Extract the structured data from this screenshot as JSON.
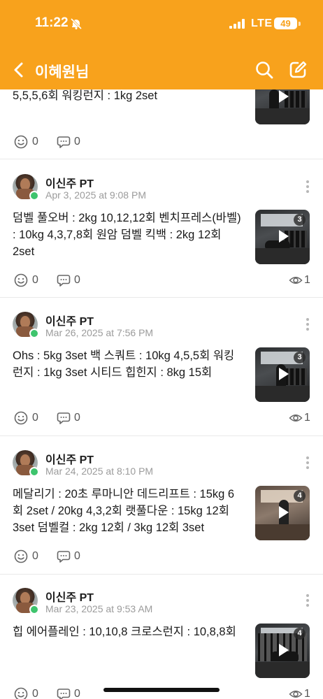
{
  "status_bar": {
    "time": "11:22",
    "network": "LTE",
    "battery": "49"
  },
  "nav": {
    "title": "이혜원님"
  },
  "colors": {
    "header": "#f8a21c",
    "badge": "#3ec46d"
  },
  "posts": [
    {
      "text": "5,5,5,6회 워킹런지 : 1kg 2set",
      "reactions": "0",
      "comments": "0"
    },
    {
      "author": "이신주 PT",
      "date": "Apr 3, 2025 at 9:08 PM",
      "text": "덤벨 풀오버 : 2kg 10,12,12회 벤치프레스(바벨) : 10kg 4,3,7,8회 원암 덤벨 킥백 : 2kg 12회 2set",
      "media_count": "3",
      "reactions": "0",
      "comments": "0",
      "views": "1"
    },
    {
      "author": "이신주 PT",
      "date": "Mar 26, 2025 at 7:56 PM",
      "text": "Ohs : 5kg 3set 백 스쿼트 : 10kg 4,5,5회 워킹런지 : 1kg 3set 시티드 힙힌지 : 8kg 15회",
      "media_count": "3",
      "reactions": "0",
      "comments": "0",
      "views": "1"
    },
    {
      "author": "이신주 PT",
      "date": "Mar 24, 2025 at 8:10 PM",
      "text": "메달리기 : 20초 루마니안 데드리프트 : 15kg 6회 2set / 20kg 4,3,2회 랫풀다운 : 15kg 12회 3set 덤벨컬 : 2kg 12회 / 3kg 12회 3set",
      "media_count": "4",
      "reactions": "0",
      "comments": "0"
    },
    {
      "author": "이신주 PT",
      "date": "Mar 23, 2025 at 9:53 AM",
      "text": "힙 에어플레인 : 10,10,8 크로스런지 : 10,8,8회",
      "media_count": "4",
      "reactions": "0",
      "comments": "0",
      "views": "1"
    }
  ]
}
